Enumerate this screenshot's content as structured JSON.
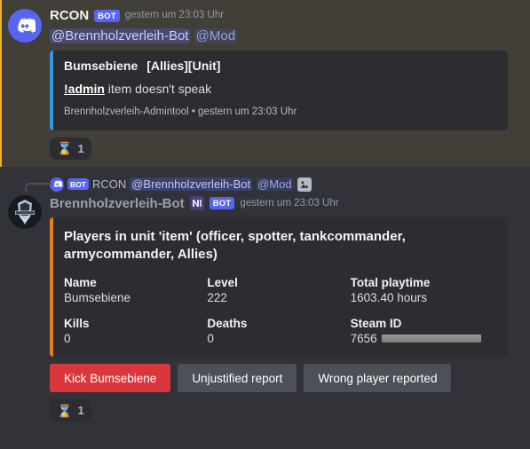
{
  "theme": {
    "background": "#313338",
    "mention_background": "#413f38",
    "embed_background": "#2b2d31",
    "accent_blurple": "#5865f2",
    "embed_accent_blue": "#3498db",
    "embed_accent_orange": "#e67e22",
    "danger_red": "#da373c",
    "secondary_gray": "#4e5058"
  },
  "messages": [
    {
      "id": "message-rcon-admin-report",
      "avatar_icon": "discord-logo-icon",
      "author": "RCON",
      "bot_tag": "BOT",
      "timestamp": "gestern um 23:03 Uhr",
      "content_mentions": [
        {
          "text": "@Brennholzverleih-Bot",
          "type": "user"
        },
        {
          "text": "@Mod",
          "type": "role"
        }
      ],
      "embed": {
        "accent": "blue",
        "player_name": "Bumsebiene",
        "tags": "[Allies][Unit]",
        "command": "!admin",
        "description": "item doesn't speak",
        "footer": "Brennholzverleih-Admintool • gestern um 23:03 Uhr"
      },
      "reaction": {
        "emoji": "hourglass-icon",
        "glyph": "⌛",
        "count": "1"
      }
    },
    {
      "id": "message-brennholzverleih-bot-unit-players",
      "avatar_icon": "server-crest-icon",
      "reply_reference": {
        "avatar_icon": "discord-logo-icon",
        "bot_tag": "BOT",
        "author": "RCON",
        "mentions": [
          {
            "text": "@Brennholzverleih-Bot",
            "type": "user"
          },
          {
            "text": "@Mod",
            "type": "role"
          }
        ],
        "attachment_icon": "image-attachment-icon"
      },
      "author": "Brennholzverleih-Bot",
      "author_badge_icon": "custom-emoji-icon",
      "bot_tag": "BOT",
      "timestamp": "gestern um 23:03 Uhr",
      "embed": {
        "accent": "orange",
        "title": "Players in unit 'item' (officer, spotter, tankcommander, armycommander, Allies)",
        "fields": [
          {
            "name": "Name",
            "value": "Bumsebiene"
          },
          {
            "name": "Level",
            "value": "222"
          },
          {
            "name": "Total playtime",
            "value": "1603.40 hours"
          },
          {
            "name": "Kills",
            "value": "0"
          },
          {
            "name": "Deaths",
            "value": "0"
          },
          {
            "name": "Steam ID",
            "value": "7656",
            "redacted": true
          }
        ]
      },
      "buttons": [
        {
          "label": "Kick Bumsebiene",
          "style": "danger"
        },
        {
          "label": "Unjustified report",
          "style": "secondary"
        },
        {
          "label": "Wrong player reported",
          "style": "secondary"
        }
      ],
      "reaction": {
        "emoji": "hourglass-icon",
        "glyph": "⌛",
        "count": "1"
      }
    }
  ]
}
